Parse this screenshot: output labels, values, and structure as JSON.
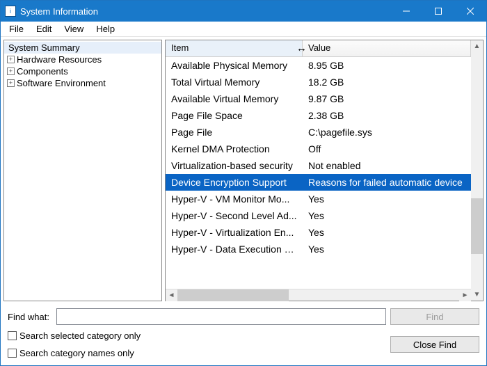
{
  "window": {
    "title": "System Information"
  },
  "menu": {
    "file": "File",
    "edit": "Edit",
    "view": "View",
    "help": "Help"
  },
  "tree": {
    "summary": "System Summary",
    "nodes": [
      "Hardware Resources",
      "Components",
      "Software Environment"
    ]
  },
  "columns": {
    "item": "Item",
    "value": "Value"
  },
  "rows": [
    {
      "item": "Available Physical Memory",
      "value": "8.95 GB",
      "selected": false
    },
    {
      "item": "Total Virtual Memory",
      "value": "18.2 GB",
      "selected": false
    },
    {
      "item": "Available Virtual Memory",
      "value": "9.87 GB",
      "selected": false
    },
    {
      "item": "Page File Space",
      "value": "2.38 GB",
      "selected": false
    },
    {
      "item": "Page File",
      "value": "C:\\pagefile.sys",
      "selected": false
    },
    {
      "item": "Kernel DMA Protection",
      "value": "Off",
      "selected": false
    },
    {
      "item": "Virtualization-based security",
      "value": "Not enabled",
      "selected": false
    },
    {
      "item": "Device Encryption Support",
      "value": "Reasons for failed automatic device",
      "selected": true
    },
    {
      "item": "Hyper-V - VM Monitor Mo...",
      "value": "Yes",
      "selected": false
    },
    {
      "item": "Hyper-V - Second Level Ad...",
      "value": "Yes",
      "selected": false
    },
    {
      "item": "Hyper-V - Virtualization En...",
      "value": "Yes",
      "selected": false
    },
    {
      "item": "Hyper-V - Data Execution P...",
      "value": "Yes",
      "selected": false
    }
  ],
  "find": {
    "label": "Find what:",
    "value": "",
    "findBtn": "Find",
    "closeBtn": "Close Find",
    "opt1": "Search selected category only",
    "opt2": "Search category names only"
  }
}
